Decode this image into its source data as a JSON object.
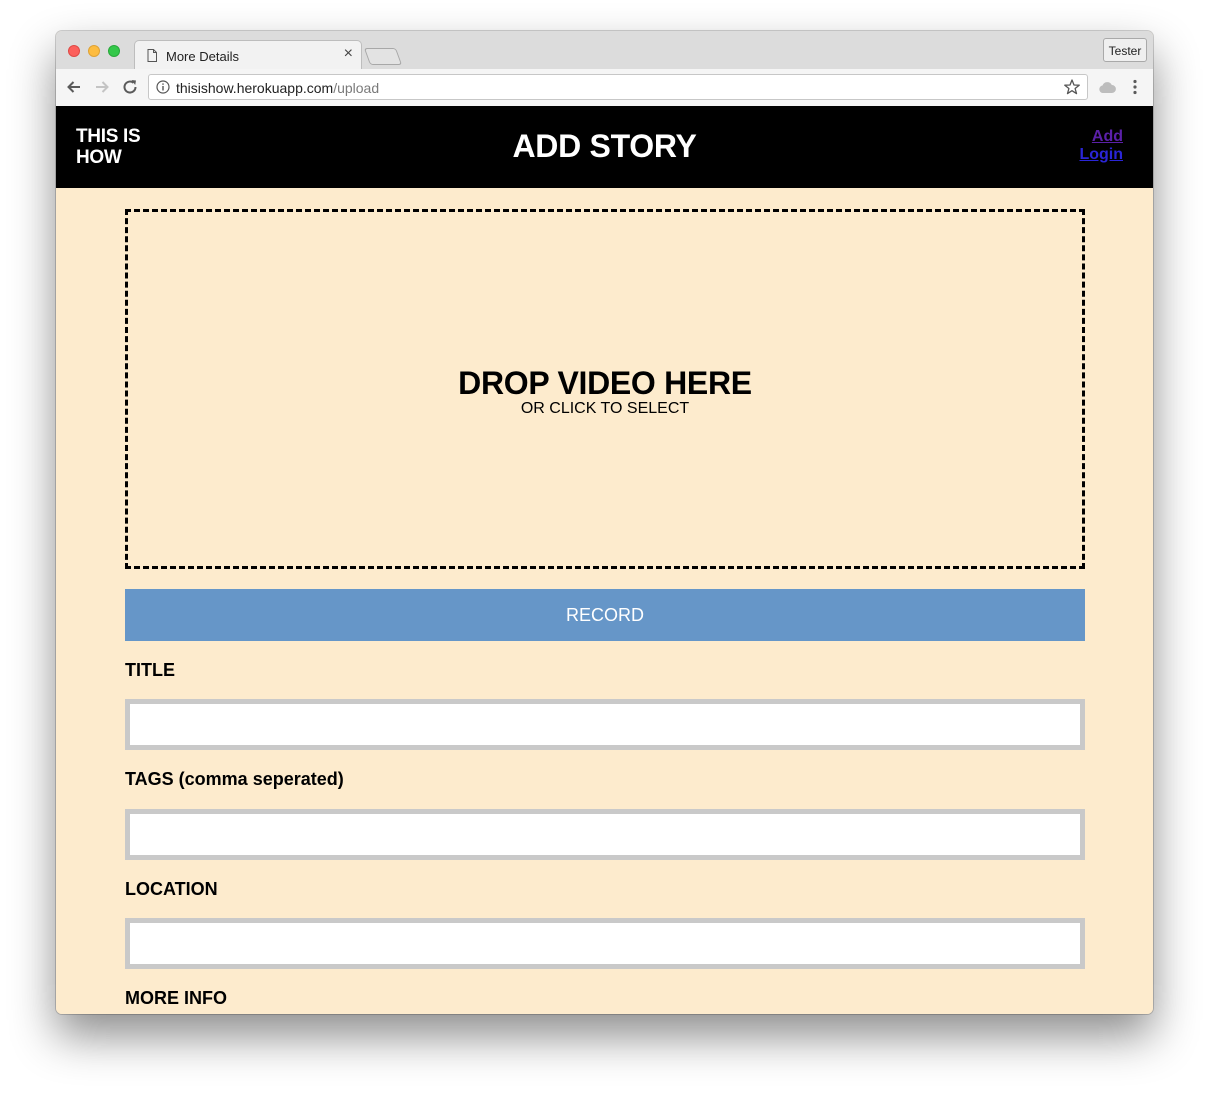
{
  "browser": {
    "tab_title": "More Details",
    "tab_close": "×",
    "profile_label": "Tester",
    "url_host": "thisishow.herokuapp.com",
    "url_path": "/upload"
  },
  "header": {
    "brand": "THIS IS HOW",
    "title": "ADD STORY",
    "links": {
      "add": "Add",
      "login": "Login"
    }
  },
  "dropzone": {
    "title": "DROP VIDEO HERE",
    "subtitle": "OR CLICK TO SELECT"
  },
  "record_button": "RECORD",
  "form": {
    "title_label": "TITLE",
    "title_value": "",
    "tags_label": "TAGS (comma seperated)",
    "tags_value": "",
    "location_label": "LOCATION",
    "location_value": "",
    "more_info_label": "MORE INFO"
  },
  "colors": {
    "page_bg": "#fdebcd",
    "header_bg": "#000000",
    "record_bg": "#6696c8",
    "link_add": "#5b20a8",
    "link_login": "#2a25d6"
  }
}
